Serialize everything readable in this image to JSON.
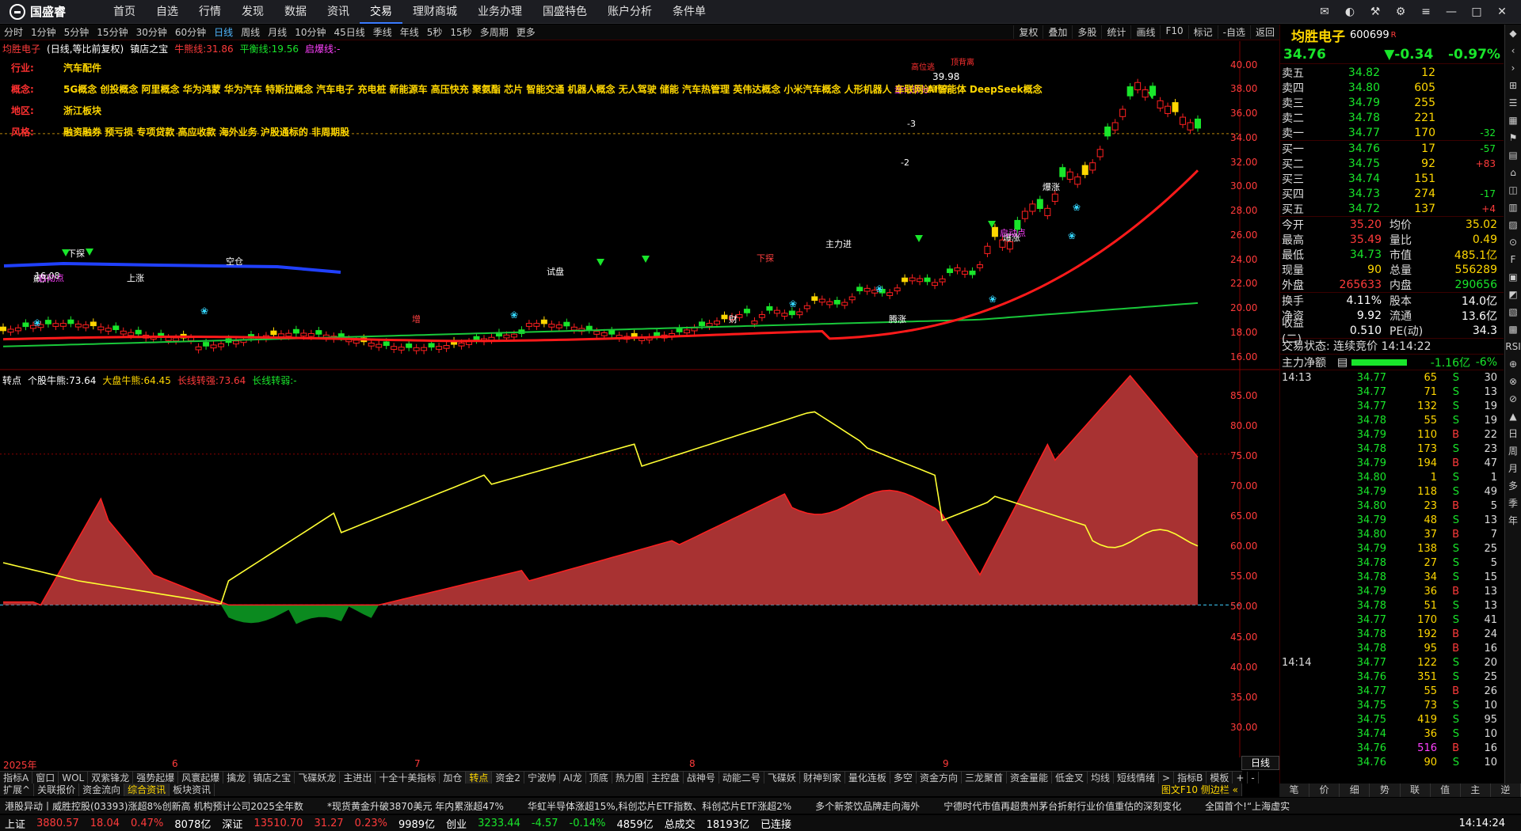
{
  "app": {
    "logo": "国盛睿"
  },
  "nav": [
    "首页",
    "自选",
    "行情",
    "发现",
    "数据",
    "资讯",
    "交易",
    "理财商城",
    "业务办理",
    "国盛特色",
    "账户分析",
    "条件单"
  ],
  "nav_active": 6,
  "periods": [
    "分时",
    "1分钟",
    "5分钟",
    "15分钟",
    "30分钟",
    "60分钟",
    "日线",
    "周线",
    "月线",
    "10分钟",
    "45日线",
    "季线",
    "年线",
    "5秒",
    "15秒",
    "多周期",
    "更多"
  ],
  "period_active": 6,
  "tools": [
    "复权",
    "叠加",
    "多股",
    "统计",
    "画线",
    "F10",
    "标记",
    "-自选",
    "返回"
  ],
  "info": {
    "name": "均胜电子",
    "mode": "(日线,等比前复权)",
    "indicator": "镇店之宝",
    "bull_label": "牛熊线:",
    "bull_val": "31.86",
    "flat_label": "平衡线:",
    "flat_val": "19.56",
    "start_label": "启爆线:",
    "start_val": "-"
  },
  "concepts": [
    {
      "label": "行业:",
      "value": "汽车配件"
    },
    {
      "label": "概念:",
      "value": "5G概念 创投概念 阿里概念 华为鸿蒙 华为汽车 特斯拉概念 汽车电子 充电桩 新能源车 高压快充 聚氨酯 芯片 智能交通 机器人概念 无人驾驶 储能 汽车热管理 英伟达概念 小米汽车概念 人形机器人 车联网 AI智能体 DeepSeek概念"
    },
    {
      "label": "地区:",
      "value": "浙江板块"
    },
    {
      "label": "风格:",
      "value": "融资融券 预亏损 专项贷款 高应收款 海外业务 沪股通标的 非周期股"
    }
  ],
  "axis_main": [
    "40.00",
    "38.00",
    "36.00",
    "34.00",
    "32.00",
    "30.00",
    "28.00",
    "26.00",
    "24.00",
    "22.00",
    "20.00",
    "18.00",
    "16.00"
  ],
  "axis_ind": [
    "85.00",
    "80.00",
    "75.00",
    "70.00",
    "65.00",
    "60.00",
    "55.00",
    "50.00",
    "45.00",
    "40.00",
    "35.00",
    "30.00"
  ],
  "ind2": {
    "name": "转点",
    "stock_label": "个股牛熊:",
    "stock_val": "73.64",
    "market_label": "大盘牛熊:",
    "market_val": "64.45",
    "long_label": "长线转强:",
    "long_val": "73.64",
    "long2_label": "长线转弱:",
    "long2_val": "-"
  },
  "chart_labels": {
    "high_price": "39.98",
    "low_price": "16.08",
    "high_mark": "高位逃",
    "quant": "量化评分",
    "new_high": "创新高",
    "top_zone": "顶背离",
    "tags": [
      "飙升",
      "下探",
      "空仓",
      "下探",
      "增",
      "财",
      "腾涨",
      "爆涨",
      "爆涨",
      "启动点",
      "启动点",
      "试盘",
      "主力进",
      "-2",
      "-3",
      "上涨"
    ]
  },
  "date_marks": [
    "2025年",
    "6",
    "7",
    "8",
    "9"
  ],
  "corner_label": "日线",
  "tabs1": [
    "指标A",
    "窗口",
    "WOL",
    "双紫锋龙",
    "强势起爆",
    "风寰起爆",
    "擒龙",
    "镇店之宝",
    "飞碟妖龙",
    "主进出",
    "十全十美指标",
    "加仓",
    "转点",
    "资金2",
    "宁波帅",
    "AI龙",
    "顶底",
    "热力图",
    "主控盘",
    "战神号",
    "动能二号",
    "飞碟妖",
    "财神到家",
    "量化连板",
    "多空",
    "资金方向",
    "三龙聚首",
    "资金量能",
    "低金叉",
    "均线",
    "短线情绪",
    ">"
  ],
  "tabs1_active": 12,
  "tabs1_right": [
    "指标B",
    "模板",
    "+",
    "-"
  ],
  "tabs2": [
    "扩展^",
    "关联报价",
    "资金流向",
    "综合资讯",
    "板块资讯"
  ],
  "tabs2_active": 3,
  "tabs2_right": "图文F10 侧边栏 «",
  "quote": {
    "name": "均胜电子",
    "code": "600699",
    "flag": "R",
    "price": "34.76",
    "change": "▼-0.34",
    "pct": "-0.97%"
  },
  "sell": [
    [
      "卖五",
      "34.82",
      "12",
      ""
    ],
    [
      "卖四",
      "34.80",
      "605",
      ""
    ],
    [
      "卖三",
      "34.79",
      "255",
      ""
    ],
    [
      "卖二",
      "34.78",
      "221",
      ""
    ],
    [
      "卖一",
      "34.77",
      "170",
      "-32"
    ]
  ],
  "buy": [
    [
      "买一",
      "34.76",
      "17",
      "-57"
    ],
    [
      "买二",
      "34.75",
      "92",
      "+83"
    ],
    [
      "买三",
      "34.74",
      "151",
      ""
    ],
    [
      "买四",
      "34.73",
      "274",
      "-17"
    ],
    [
      "买五",
      "34.72",
      "137",
      "+4"
    ]
  ],
  "stats": [
    [
      "今开",
      "35.20",
      "均价",
      "35.02"
    ],
    [
      "最高",
      "35.49",
      "量比",
      "0.49"
    ],
    [
      "最低",
      "34.73",
      "市值",
      "485.1亿"
    ],
    [
      "现量",
      "90",
      "总量",
      "556289"
    ],
    [
      "外盘",
      "265633",
      "内盘",
      "290656"
    ]
  ],
  "stats2": [
    [
      "换手",
      "4.11%",
      "股本",
      "14.0亿"
    ],
    [
      "净资",
      "9.92",
      "流通",
      "13.6亿"
    ],
    [
      "收益(二)",
      "0.510",
      "PE(动)",
      "34.3"
    ]
  ],
  "trade_status": "交易状态: 连续竞价 14:14:22",
  "main_flow": {
    "label": "主力净额",
    "val": "-1.16亿",
    "pct": "-6%"
  },
  "ticks_1413": [
    [
      "34.77",
      "65",
      "S",
      "30"
    ],
    [
      "34.77",
      "71",
      "S",
      "13"
    ],
    [
      "34.77",
      "132",
      "S",
      "19"
    ],
    [
      "34.78",
      "55",
      "S",
      "19"
    ],
    [
      "34.79",
      "110",
      "B",
      "22"
    ],
    [
      "34.78",
      "173",
      "S",
      "23"
    ],
    [
      "34.79",
      "194",
      "B",
      "47"
    ],
    [
      "34.80",
      "1",
      "S",
      "1"
    ],
    [
      "34.79",
      "118",
      "S",
      "49"
    ],
    [
      "34.80",
      "23",
      "B",
      "5"
    ],
    [
      "34.79",
      "48",
      "S",
      "13"
    ],
    [
      "34.80",
      "37",
      "B",
      "7"
    ],
    [
      "34.79",
      "138",
      "S",
      "25"
    ],
    [
      "34.78",
      "27",
      "S",
      "5"
    ],
    [
      "34.78",
      "34",
      "S",
      "15"
    ],
    [
      "34.79",
      "36",
      "B",
      "13"
    ],
    [
      "34.78",
      "51",
      "S",
      "13"
    ],
    [
      "34.77",
      "170",
      "S",
      "41"
    ],
    [
      "34.78",
      "192",
      "B",
      "24"
    ],
    [
      "34.78",
      "95",
      "B",
      "16"
    ]
  ],
  "ticks_1414": [
    [
      "34.77",
      "122",
      "S",
      "20"
    ],
    [
      "34.76",
      "351",
      "S",
      "25"
    ],
    [
      "34.77",
      "55",
      "B",
      "26"
    ],
    [
      "34.75",
      "73",
      "S",
      "10"
    ],
    [
      "34.75",
      "419",
      "S",
      "95"
    ],
    [
      "34.74",
      "36",
      "S",
      "10"
    ],
    [
      "34.76",
      "516",
      "B",
      "16"
    ],
    [
      "34.76",
      "90",
      "S",
      "10"
    ]
  ],
  "time1": "14:13",
  "time2": "14:14",
  "rbottom": [
    "笔",
    "价",
    "细",
    "势",
    "联",
    "值",
    "主",
    "逆"
  ],
  "rside": [
    "日",
    "周",
    "月",
    "多",
    "季",
    "年"
  ],
  "news": [
    "港股异动丨威胜控股(03393)涨超8%创新高 机构预计公司2025全年数",
    "*现货黄金升破3870美元 年内累涨超47%",
    "华虹半导体涨超15%,科创芯片ETF指数、科创芯片ETF涨超2%",
    "多个新茶饮品牌走向海外",
    "宁德时代市值再超贵州茅台折射行业价值重估的深刻变化",
    "全国首个!“上海虚实"
  ],
  "status": [
    {
      "n": "上证",
      "p": "3880.57",
      "c": "18.04",
      "r": "0.47%",
      "a": "8078亿"
    },
    {
      "n": "深证",
      "p": "13510.70",
      "c": "31.27",
      "r": "0.23%",
      "a": "9989亿"
    },
    {
      "n": "创业",
      "p": "3233.44",
      "c": "-4.57",
      "r": "-0.14%",
      "a": "4859亿"
    }
  ],
  "total": {
    "label": "总成交",
    "val": "18193亿",
    "conn": "已连接",
    "time": "14:14:24"
  }
}
